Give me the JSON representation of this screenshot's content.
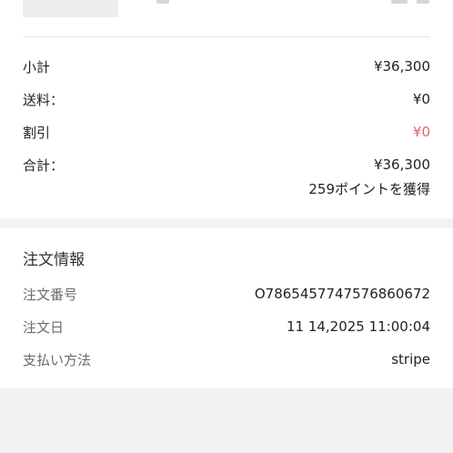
{
  "summary": {
    "subtotal": {
      "label": "小計",
      "value": "¥36,300"
    },
    "shipping": {
      "label": "送料：",
      "value": "¥0"
    },
    "discount": {
      "label": "割引",
      "value": "¥0"
    },
    "total": {
      "label": "合計：",
      "value": "¥36,300"
    },
    "points_note": "259ポイントを獲得"
  },
  "order_info": {
    "title": "注文情報",
    "order_number": {
      "label": "注文番号",
      "value": "O7865457747576860672"
    },
    "order_date": {
      "label": "注文日",
      "value": "11 14,2025 11:00:04"
    },
    "payment_method": {
      "label": "支払い方法",
      "value": "stripe"
    }
  },
  "colors": {
    "discount_value": "#d9666f",
    "page_background": "#f2f2f2",
    "card_background": "#ffffff"
  }
}
